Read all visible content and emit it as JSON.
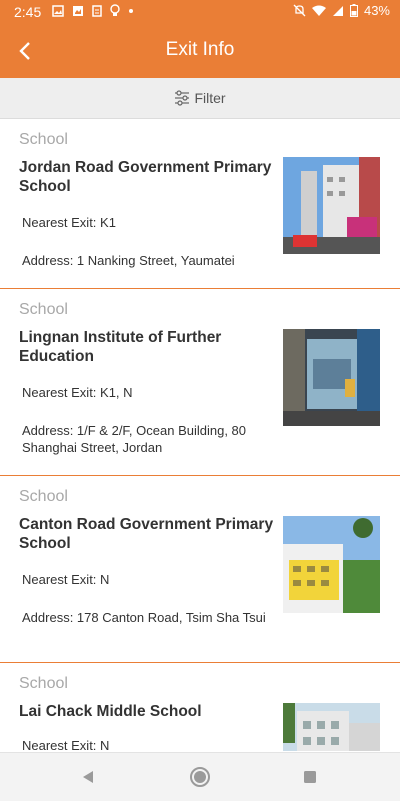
{
  "status": {
    "time": "2:45",
    "battery": "43%"
  },
  "appbar": {
    "title": "Exit Info"
  },
  "filter": {
    "label": "Filter"
  },
  "items": [
    {
      "category": "School",
      "name": "Jordan Road Government Primary School",
      "exit": "Nearest Exit: K1",
      "address": "Address: 1 Nanking Street, Yaumatei"
    },
    {
      "category": "School",
      "name": "Lingnan Institute of Further Education",
      "exit": "Nearest Exit: K1, N",
      "address": "Address: 1/F & 2/F, Ocean Building, 80 Shanghai Street, Jordan"
    },
    {
      "category": "School",
      "name": "Canton Road Government Primary School",
      "exit": "Nearest Exit: N",
      "address": "Address: 178 Canton Road, Tsim Sha Tsui"
    },
    {
      "category": "School",
      "name": "Lai Chack Middle School",
      "exit": "Nearest Exit: N",
      "address": ""
    }
  ],
  "colors": {
    "accent": "#ea7e36",
    "filterbar": "#eeeeee"
  }
}
